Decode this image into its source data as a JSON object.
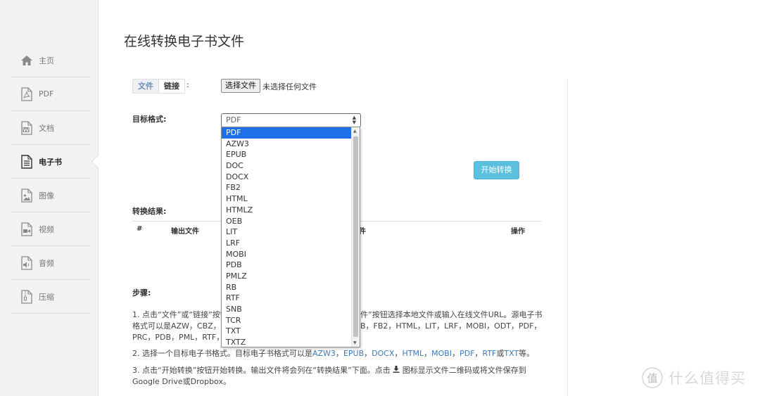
{
  "sidebar": {
    "items": [
      {
        "label": "主页",
        "icon": "home-icon"
      },
      {
        "label": "PDF",
        "icon": "pdf-file-icon"
      },
      {
        "label": "文档",
        "icon": "word-file-icon"
      },
      {
        "label": "电子书",
        "icon": "ebook-file-icon"
      },
      {
        "label": "图像",
        "icon": "image-file-icon"
      },
      {
        "label": "视频",
        "icon": "video-file-icon"
      },
      {
        "label": "音频",
        "icon": "audio-file-icon"
      },
      {
        "label": "压缩",
        "icon": "archive-file-icon"
      }
    ],
    "active_label": "电子书"
  },
  "page_title": "在线转换电子书文件",
  "source": {
    "tab_file": "文件",
    "tab_link": "链接",
    "colon": ":",
    "file_button": "选择文件",
    "no_file": "未选择任何文件"
  },
  "target": {
    "label": "目标格式:",
    "selected": "PDF",
    "options": [
      "PDF",
      "AZW3",
      "EPUB",
      "DOC",
      "DOCX",
      "FB2",
      "HTML",
      "HTMLZ",
      "OEB",
      "LIT",
      "LRF",
      "MOBI",
      "PDB",
      "PMLZ",
      "RB",
      "RTF",
      "SNB",
      "TCR",
      "TXT",
      "TXTZ"
    ]
  },
  "start_button": "开始转换",
  "result": {
    "label": "转换结果:",
    "col_num": "#",
    "col_output": "输出文件",
    "col_partial": "件",
    "col_action": "操作"
  },
  "steps": {
    "label": "步骤:",
    "s1_a": "1. 点击“文件”或“链接”按钮",
    "s1_b": "件”按钮选择本地文件或输入在线文件URL。源电子书",
    "s1_c": "格式可以是AZW，CBZ，C",
    "s1_d": "B，FB2，HTML，LIT，LRF，MOBI，ODT，PDF，",
    "s1_e": "PRC，PDB，PML，RTF，",
    "s2_prefix": "2. 选择一个目标电子书格式。目标电子书格式可以是",
    "s2_links": [
      "AZW3",
      "EPUB",
      "DOCX",
      "HTML",
      "MOBI",
      "PDF",
      "RTF"
    ],
    "s2_sep": "，",
    "s2_or": "或",
    "s2_last": "TXT",
    "s2_suffix": "等。",
    "s3_a": "3. 点击“开始转换”按钮开始转换。输出文件将会列在“转换结果”下面。点击",
    "s3_b": "图标显示文件二维码或将文件保存到",
    "s3_c": "Google Drive或Dropbox。"
  },
  "watermark": {
    "badge": "值",
    "text": "什么值得买"
  },
  "colors": {
    "accent": "#5bc0de",
    "link": "#3d7ab8",
    "selected_option": "#1e6fe8"
  }
}
